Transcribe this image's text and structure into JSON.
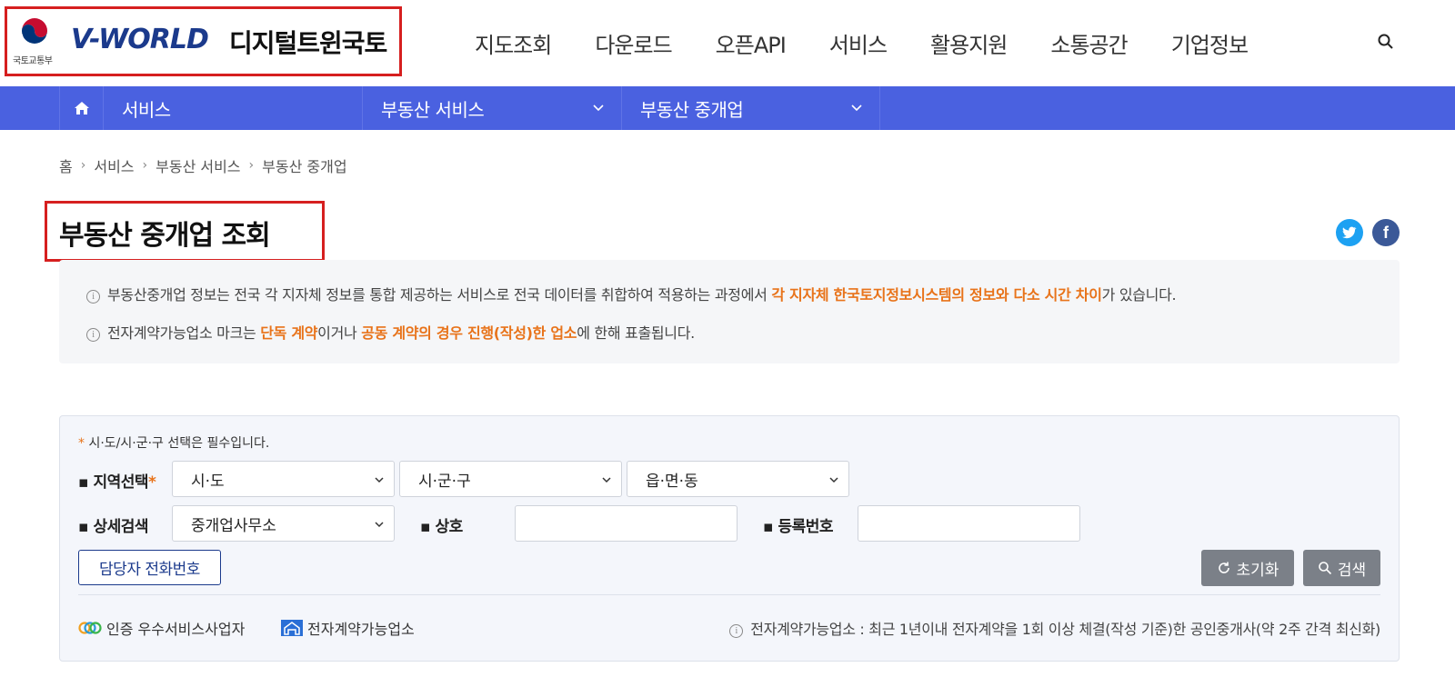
{
  "header": {
    "ministry": "국토교통부",
    "brand": "V-WORLD",
    "brand_suffix": "디지털트윈국토",
    "nav": [
      "지도조회",
      "다운로드",
      "오픈API",
      "서비스",
      "활용지원",
      "소통공간",
      "기업정보"
    ]
  },
  "subnav": {
    "items": [
      "서비스",
      "부동산 서비스",
      "부동산 중개업"
    ]
  },
  "breadcrumb": [
    "홈",
    "서비스",
    "부동산 서비스",
    "부동산 중개업"
  ],
  "page": {
    "title": "부동산 중개업 조회"
  },
  "notice": {
    "line1_a": "부동산중개업 정보는 전국 각 지자체 정보를 통합 제공하는 서비스로 전국 데이터를 취합하여 적용하는 과정에서 ",
    "line1_hl": "각 지자체 한국토지정보시스템의 정보와 다소 시간 차이",
    "line1_b": "가 있습니다.",
    "line2_a": "전자계약가능업소 마크는 ",
    "line2_hl1": "단독 계약",
    "line2_b": "이거나 ",
    "line2_hl2": "공동 계약의 경우 진행(작성)한 업소",
    "line2_c": "에 한해 표출됩니다."
  },
  "search": {
    "required_note": "시·도/시·군·구 선택은 필수입니다.",
    "region_label": "지역선택",
    "sido": "시·도",
    "sigungu": "시·군·구",
    "emd": "읍·면·동",
    "detail_label": "상세검색",
    "detail_value": "중개업사무소",
    "name_label": "상호",
    "regno_label": "등록번호",
    "phone_button": "담당자 전화번호",
    "reset_button": "초기화",
    "search_button": "검색"
  },
  "legend": {
    "certified": "인증 우수서비스사업자",
    "econtract": "전자계약가능업소",
    "note": "전자계약가능업소 : 최근 1년이내 전자계약을 1회 이상 체결(작성 기준)한 공인중개사(약 2주 간격 최신화)"
  },
  "colors": {
    "nav_bar": "#4a61e0",
    "highlight": "#e8731a",
    "brand": "#1b3a8c"
  }
}
